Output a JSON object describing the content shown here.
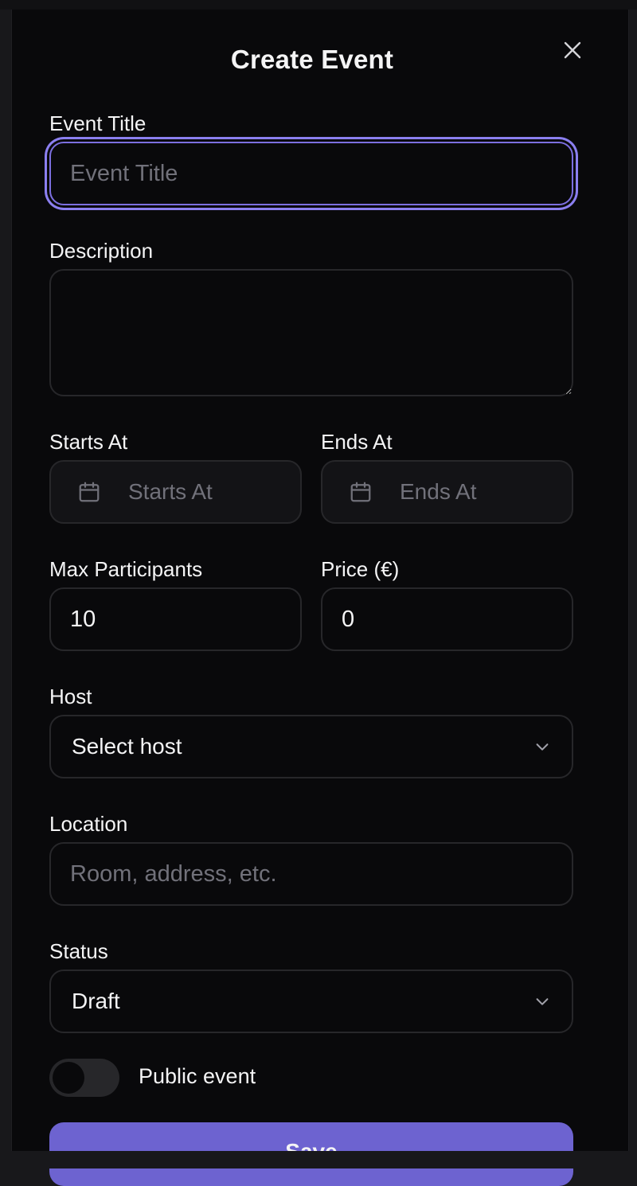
{
  "dialog": {
    "title": "Create Event",
    "close_icon": "close-icon"
  },
  "form": {
    "event_title": {
      "label": "Event Title",
      "placeholder": "Event Title",
      "value": ""
    },
    "description": {
      "label": "Description",
      "value": ""
    },
    "starts_at": {
      "label": "Starts At",
      "placeholder": "Starts At",
      "icon": "calendar-icon"
    },
    "ends_at": {
      "label": "Ends At",
      "placeholder": "Ends At",
      "icon": "calendar-icon"
    },
    "max_participants": {
      "label": "Max Participants",
      "value": "10"
    },
    "price": {
      "label": "Price (€)",
      "value": "0"
    },
    "host": {
      "label": "Host",
      "selected": "Select host",
      "icon": "chevron-down-icon"
    },
    "location": {
      "label": "Location",
      "placeholder": "Room, address, etc.",
      "value": ""
    },
    "status": {
      "label": "Status",
      "selected": "Draft",
      "icon": "chevron-down-icon"
    },
    "public_event": {
      "label": "Public event",
      "checked": false
    },
    "save_label": "Save"
  },
  "colors": {
    "background": "#09090b",
    "border": "#27272a",
    "accent": "#6d63d0",
    "focus_ring": "#8b7ff0",
    "placeholder": "#71717a"
  }
}
